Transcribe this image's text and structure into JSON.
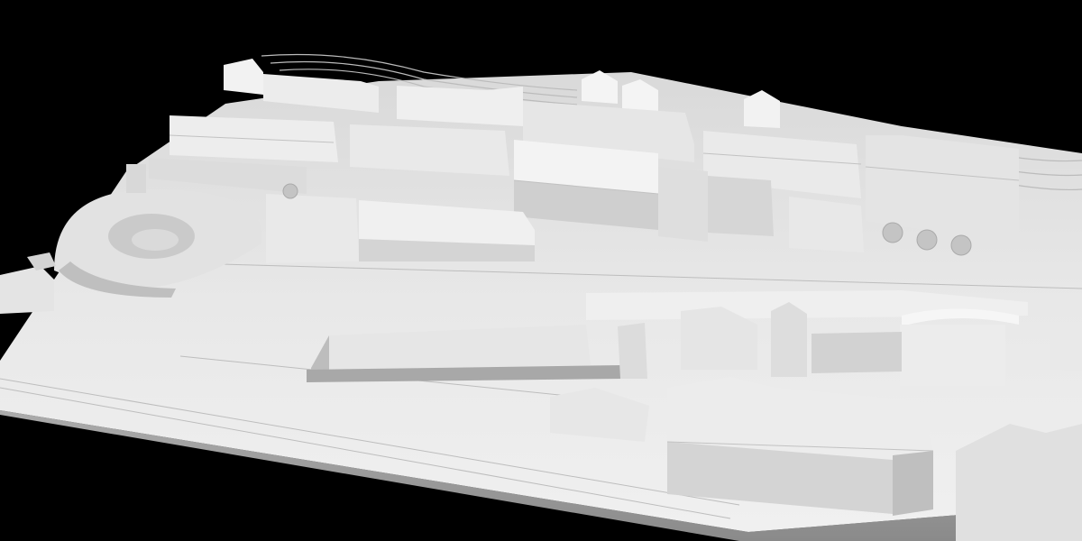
{
  "scene": {
    "subject": "white-architectural-urban-model",
    "background_color": "#000000",
    "model_base_color": "#e6e6e6",
    "roof_light_color": "#f4f4f4",
    "wall_shade_color": "#cfcfcf",
    "shadow_color": "#9a9a9a",
    "tree_color": "#bdbdbd"
  }
}
